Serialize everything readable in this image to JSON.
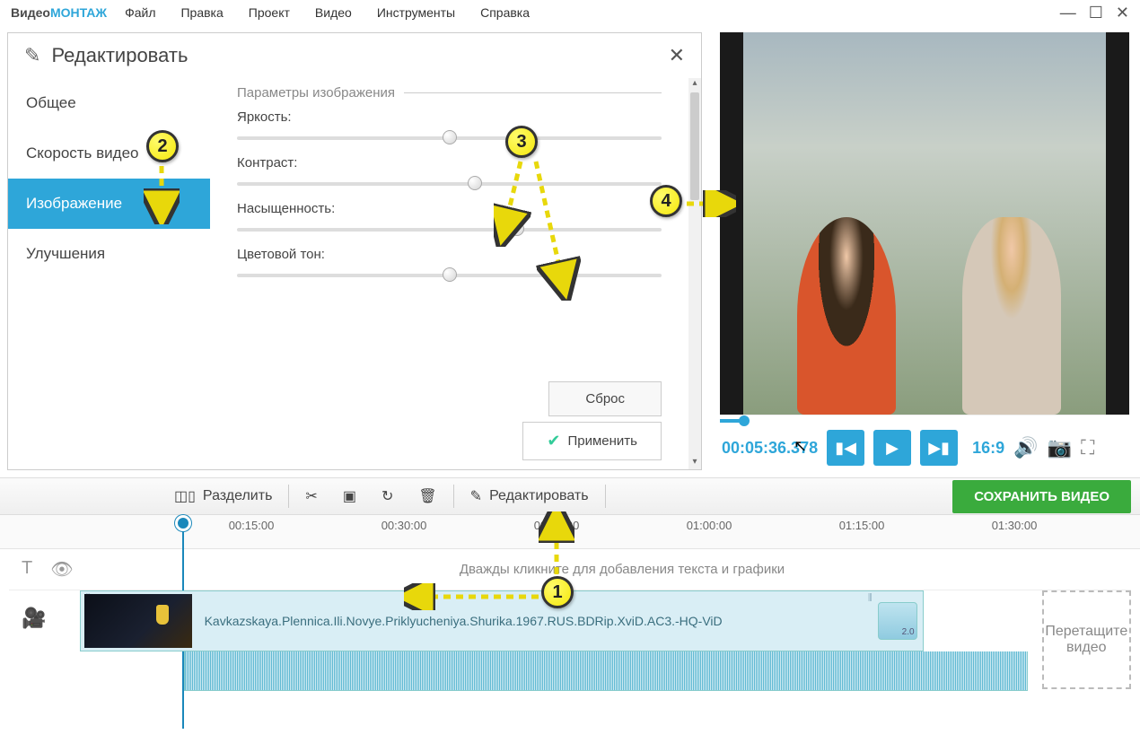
{
  "app": {
    "logo1": "Видео",
    "logo2": "МОНТАЖ"
  },
  "menu": [
    "Файл",
    "Правка",
    "Проект",
    "Видео",
    "Инструменты",
    "Справка"
  ],
  "edit": {
    "title": "Редактировать",
    "tabs": [
      "Общее",
      "Скорость видео",
      "Изображение",
      "Улучшения"
    ],
    "activeIndex": 2,
    "paramsTitle": "Параметры изображения",
    "sliders": [
      {
        "label": "Яркость:",
        "pos": 50
      },
      {
        "label": "Контраст:",
        "pos": 56
      },
      {
        "label": "Насыщенность:",
        "pos": 66
      },
      {
        "label": "Цветовой тон:",
        "pos": 50
      }
    ],
    "reset": "Сброс",
    "apply": "Применить"
  },
  "player": {
    "time": "00:05:36.378",
    "ratio": "16:9"
  },
  "toolbar": {
    "split": "Разделить",
    "edit": "Редактировать",
    "save": "СОХРАНИТЬ ВИДЕО"
  },
  "ruler": [
    "00:15:00",
    "00:30:00",
    "00:45:00",
    "01:00:00",
    "01:15:00",
    "01:30:00"
  ],
  "timeline": {
    "hint": "Дважды кликните для добавления текста и графики",
    "clipName": "Kavkazskaya.Plennica.Ili.Novye.Priklyucheniya.Shurika.1967.RUS.BDRip.XviD.AC3.-HQ-ViD",
    "clipBadge": "2.0",
    "dropHint": "Перетащите видео"
  },
  "annotations": [
    "1",
    "2",
    "3",
    "4"
  ]
}
